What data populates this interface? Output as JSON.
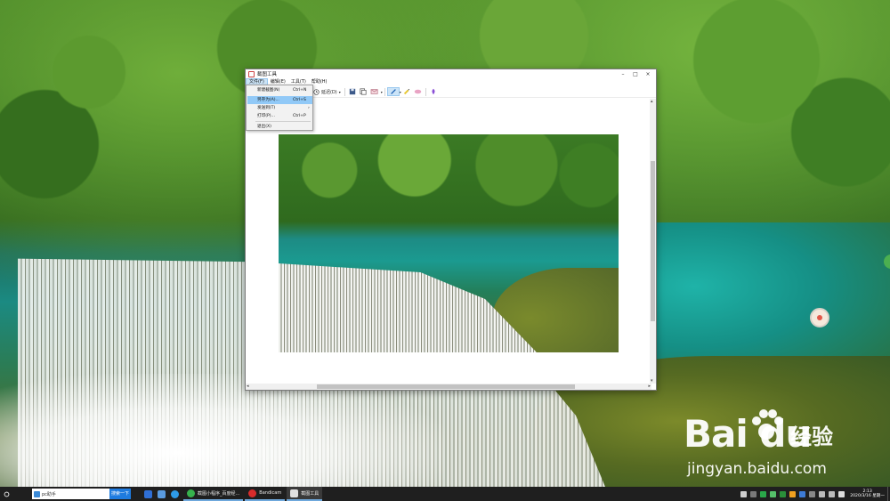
{
  "window": {
    "title": "截图工具",
    "controls": {
      "minimize": "–",
      "maximize": "□",
      "close": "×"
    }
  },
  "menubar": {
    "items": [
      {
        "label": "文件(F)"
      },
      {
        "label": "编辑(E)"
      },
      {
        "label": "工具(T)"
      },
      {
        "label": "帮助(H)"
      }
    ]
  },
  "toolbar": {
    "delay_label": "延迟(D)"
  },
  "file_menu": {
    "items": [
      {
        "label": "新建截图(N)",
        "shortcut": "Ctrl+N"
      },
      {
        "label": "另存为(A)...",
        "shortcut": "Ctrl+S"
      },
      {
        "label": "发送到(T)",
        "shortcut": "›"
      },
      {
        "label": "打印(P)...",
        "shortcut": "Ctrl+P"
      },
      {
        "label": "退出(X)",
        "shortcut": ""
      }
    ]
  },
  "taskbar": {
    "search_value": "pc助手",
    "search_button": "搜索一下",
    "windows": [
      {
        "label": "截图小程序_百度经..."
      },
      {
        "label": "Bandicam"
      },
      {
        "label": "截图工具"
      }
    ],
    "clock": {
      "time": "2:13",
      "date": "2020/3/16 星期一"
    }
  },
  "watermark": {
    "logo": "Bai  du",
    "cn": "经验",
    "url": "jingyan.baidu.com"
  },
  "colors": {
    "taskbar_bg": "#1f1f1f",
    "menu_highlight": "#91c9f7",
    "search_button": "#1e7be0"
  }
}
